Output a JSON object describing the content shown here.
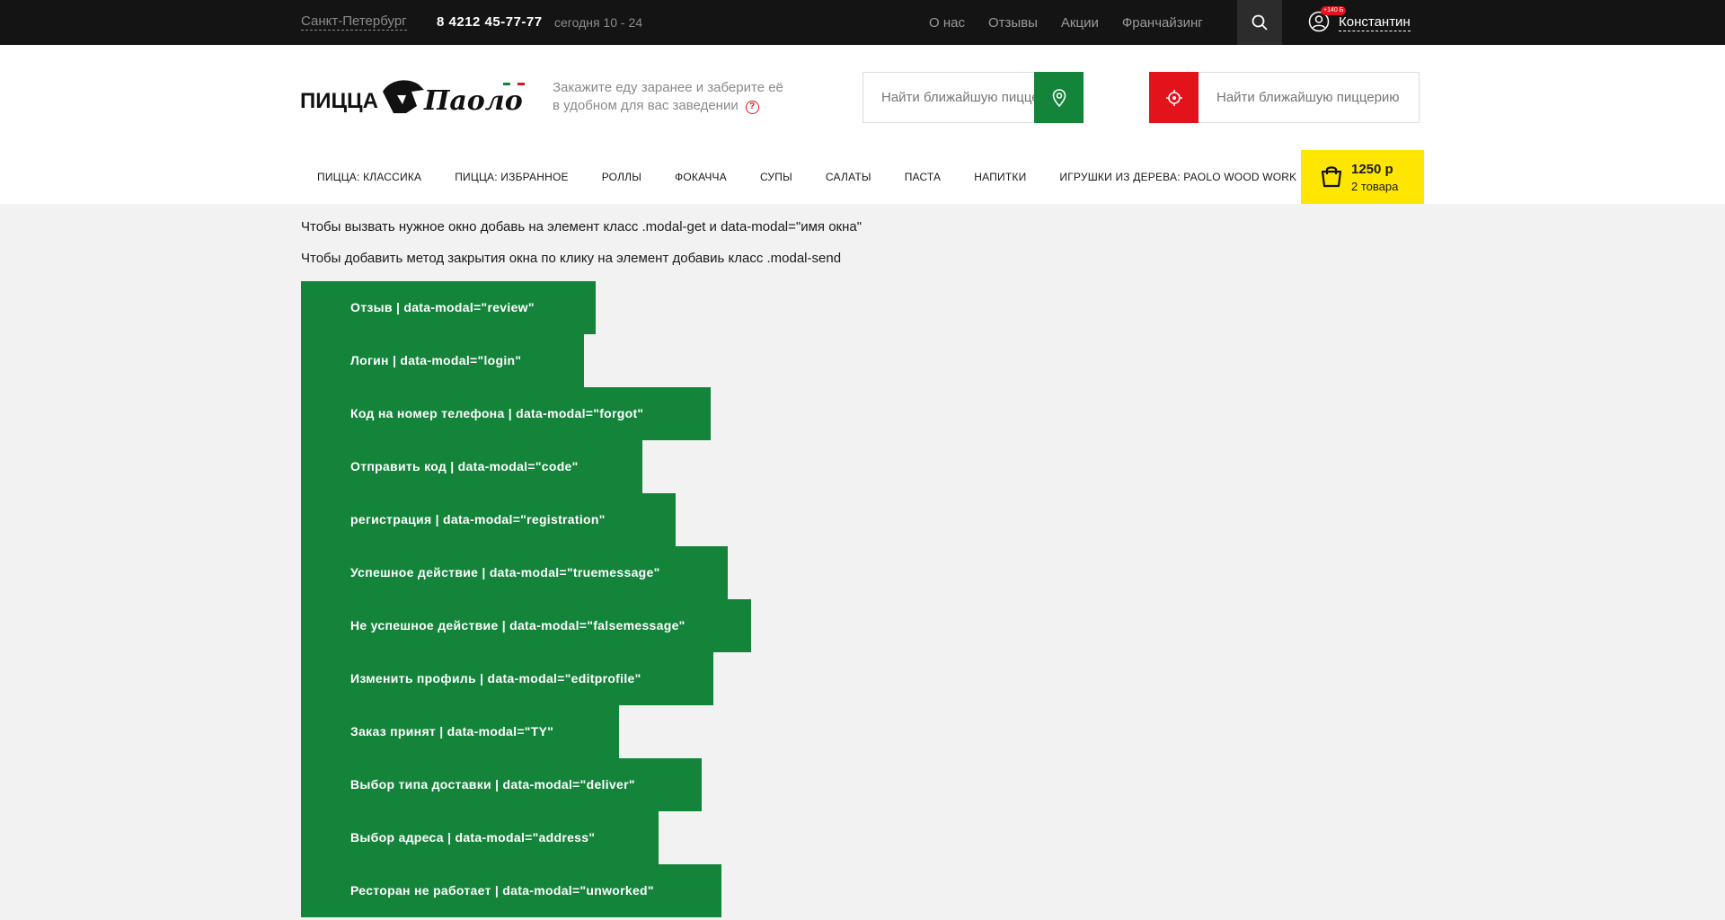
{
  "topbar": {
    "city": "Санкт-Петербург",
    "phone": "8 4212 45-77-77",
    "hours": "сегодня 10 - 24",
    "links": [
      "О нас",
      "Отзывы",
      "Акции",
      "Франчайзинг"
    ],
    "bonus": "+140 Б",
    "username": "Константин"
  },
  "header": {
    "logo_text": "ПИЦЦА Паоло",
    "tagline_line1": "Закажите еду заранее и заберите её",
    "tagline_line2": "в удобном для вас заведении",
    "tagline_help": "?",
    "search1_placeholder": "Найти ближайшую пиццерию",
    "search2_placeholder": "Найти ближайшую пиццерию"
  },
  "nav": [
    "Пицца: Классика",
    "Пицца: Избранное",
    "Роллы",
    "Фокачча",
    "Супы",
    "Салаты",
    "Паста",
    "Напитки",
    "Игрушки из дерева: Paolo Wood Work"
  ],
  "cart": {
    "sum": "1250 р",
    "count": "2 товара"
  },
  "content": {
    "note1": "Чтобы вызвать нужное окно добавь на элемент класс .modal-get и data-modal=\"имя окна\"",
    "note2": "Чтобы добавить метод закрытия окна по клику на элемент добавиь класс .modal-send",
    "buttons": [
      "Отзыв | data-modal=\"review\"",
      "Логин | data-modal=\"login\"",
      "Код на номер телефона | data-modal=\"forgot\"",
      "Отправить код | data-modal=\"code\"",
      "регистрация | data-modal=\"registration\"",
      "Успешное действие | data-modal=\"truemessage\"",
      "Не успешное действие | data-modal=\"falsemessage\"",
      "Изменить профиль | data-modal=\"editprofile\"",
      "Заказ принят | data-modal=\"TY\"",
      "Выбор типа доставки | data-modal=\"deliver\"",
      "Выбор адреса | data-modal=\"address\"",
      "Ресторан не работает | data-modal=\"unworked\""
    ]
  },
  "colors": {
    "green": "#13843a",
    "red": "#e3131b",
    "yellow": "#ffe600",
    "dark": "#141414"
  }
}
